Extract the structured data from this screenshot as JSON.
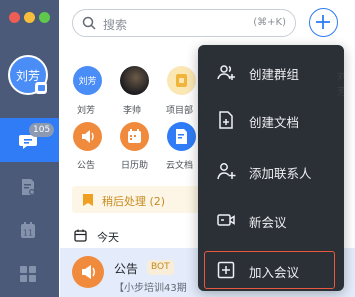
{
  "user": {
    "avatar_name": "刘芳"
  },
  "sidebar": {
    "unread_count": "105"
  },
  "search": {
    "placeholder": "搜索",
    "shortcut": "(⌘+K)"
  },
  "quick_apps": [
    {
      "label": "刘芳",
      "avatar_text": "刘芳"
    },
    {
      "label": "李帅"
    },
    {
      "label": "项目部"
    },
    {
      "label": "公告"
    },
    {
      "label": "日历助"
    },
    {
      "label": "云文档"
    }
  ],
  "banner": {
    "label": "稍后处理 (2)"
  },
  "section": {
    "title": "今天"
  },
  "conversation": {
    "title": "公告",
    "tag": "BOT",
    "preview": "【小步培训43期"
  },
  "menu": {
    "items": [
      {
        "label": "创建群组",
        "icon": "create-group-icon"
      },
      {
        "label": "创建文档",
        "icon": "create-doc-icon"
      },
      {
        "label": "添加联系人",
        "icon": "add-contact-icon"
      },
      {
        "label": "新会议",
        "icon": "new-meeting-icon"
      },
      {
        "label": "加入会议",
        "icon": "join-meeting-icon"
      }
    ]
  },
  "watermark": "刘芳",
  "colors": {
    "accent": "#2f7cf6",
    "sidebar": "#4a5a78",
    "menu_bg": "#2b2f36",
    "highlight_border": "#e8583f"
  }
}
